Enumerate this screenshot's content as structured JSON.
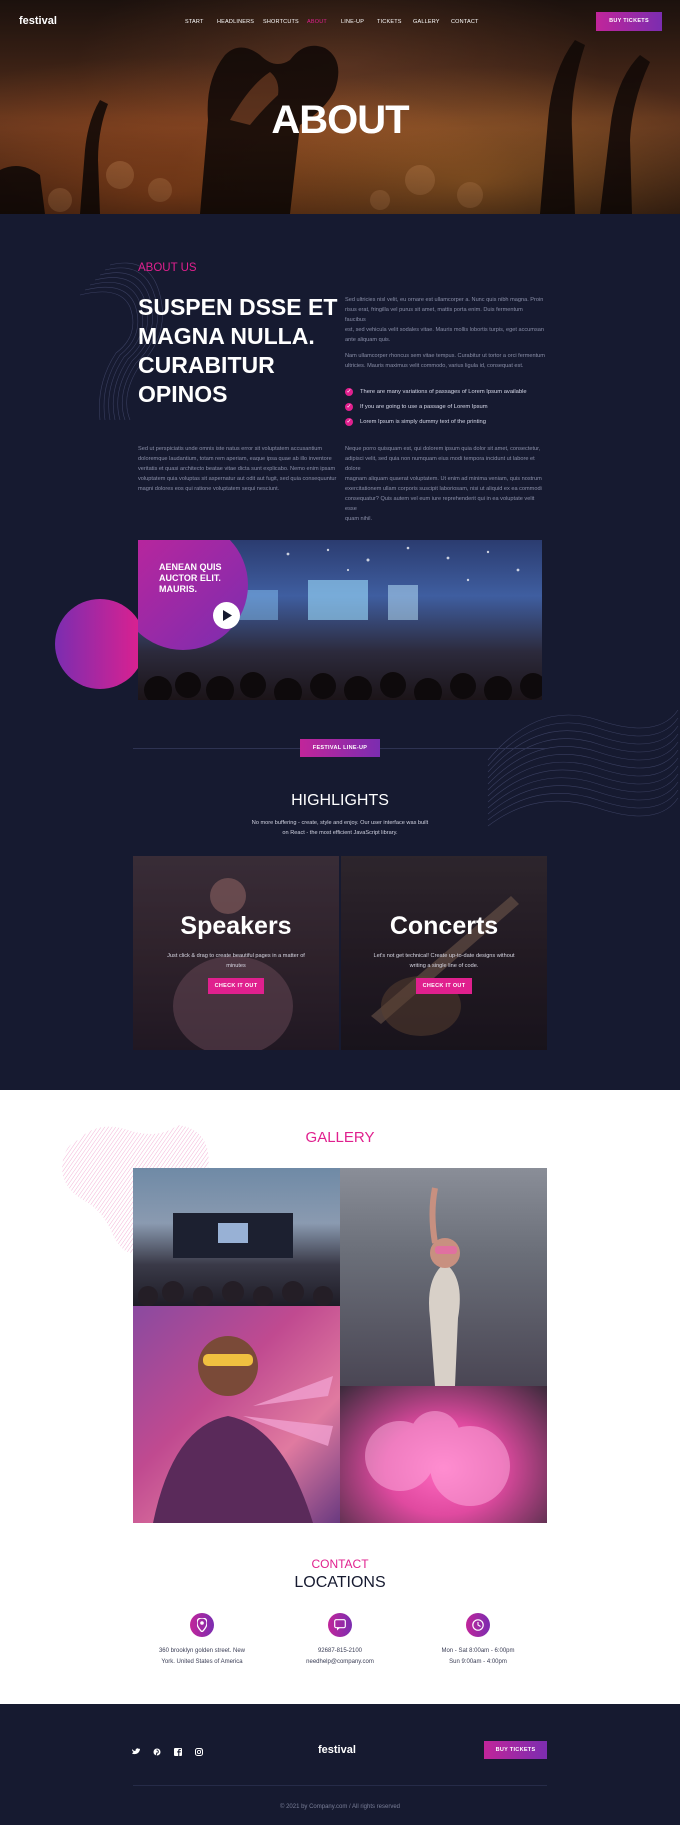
{
  "header": {
    "logo": "festival",
    "nav": [
      "START",
      "HEADLINERS",
      "SHORTCUTS",
      "ABOUT",
      "LINE-UP",
      "TICKETS",
      "GALLERY",
      "CONTACT"
    ],
    "buy_label": "BUY TICKETS"
  },
  "hero": {
    "title": "ABOUT"
  },
  "about": {
    "eyebrow": "ABOUT US",
    "heading": [
      "SUSPEN DSSE ET",
      "MAGNA NULLA.",
      "CURABITUR",
      "OPINOS"
    ],
    "right_p1": [
      "Sed ultricies nisl velit, eu ornare est ullamcorper a. Nunc quis nibh magna. Proin",
      "risus erat, fringilla vel purus sit amet, mattis porta enim. Duis fermentum faucibus",
      "est, sed vehicula velit sodales vitae. Mauris mollis lobortis turpis, eget accumsan",
      "ante aliquam quis."
    ],
    "right_p2": [
      "Nam ullamcorper rhoncus sem vitae tempus. Curabitur ut tortor a orci fermentum",
      "ultricies. Mauris maximus velit commodo, varius ligula id, consequat est."
    ],
    "checks": [
      "There are many variations of passages of Lorem Ipsum available",
      "If you are going to use a passage of Lorem Ipsum",
      "Lorem Ipsum is simply dummy text of the printing"
    ],
    "left_p3": [
      "Sed ut perspiciatis unde omnis iste natus error sit voluptatem accusantium",
      "doloremque laudantium, totam rem aperiam, eaque ipsa quae ab illo inventore",
      "veritatis et quasi architecto beatae vitae dicta sunt explicabo. Nemo enim ipsam",
      "voluptatem quia voluptas sit aspernatur aut odit aut fugit, sed quia consequuntur",
      "magni dolores eos qui ratione voluptatem sequi nesciunt."
    ],
    "right_p3": [
      "Neque porro quisquam est, qui dolorem ipsum quia dolor sit amet, consectetur,",
      "adipisci velit, sed quia non numquam eius modi tempora incidunt ut labore et dolore",
      "magnam aliquam quaerat voluptatem. Ut enim ad minima veniam, quis nostrum",
      "exercitationem ullam corporis suscipit laboriosam, nisi ut aliquid ex ea commodi",
      "consequatur? Quis autem vel eum iure reprehenderit qui in ea voluptate velit esse",
      "quam nihil."
    ]
  },
  "video": {
    "caption": [
      "AENEAN QUIS",
      "AUCTOR ELIT.",
      "MAURIS."
    ]
  },
  "lineup": {
    "badge": "FESTIVAL LINE-UP"
  },
  "highlights": {
    "title": "HIGHLIGHTS",
    "subtitle": [
      "No more buffering - create, style and enjoy. Our user interface was built",
      "on React - the most efficient JavaScript library."
    ],
    "cards": [
      {
        "title": "Speakers",
        "desc": [
          "Just click & drag to create beautiful pages in a matter of",
          "minutes"
        ],
        "button": "CHECK IT OUT"
      },
      {
        "title": "Concerts",
        "desc": [
          "Let's not get technical! Create up-to-date designs without",
          "writing a single line of code."
        ],
        "button": "CHECK IT OUT"
      }
    ]
  },
  "gallery": {
    "title": "GALLERY"
  },
  "contact": {
    "eyebrow": "CONTACT",
    "title": "LOCATIONS",
    "items": [
      {
        "icon": "location-pin-icon",
        "lines": [
          "360 brooklyn golden street. New",
          "York. United States of America"
        ]
      },
      {
        "icon": "chat-bubble-icon",
        "lines": [
          "92687-815-2100",
          "needhelp@company.com"
        ]
      },
      {
        "icon": "clock-icon",
        "lines": [
          "Mon - Sat 8:00am - 6:00pm",
          "Sun 9:00am - 4:00pm"
        ]
      }
    ]
  },
  "footer": {
    "logo": "festival",
    "buy_label": "BUY TICKETS",
    "social_icons": [
      "twitter-icon",
      "pinterest-icon",
      "facebook-icon",
      "instagram-icon"
    ],
    "copyright": "© 2021 by Company.com  /  All rights reserved"
  },
  "colors": {
    "accent": "#e0208e",
    "accent2": "#7b2db0",
    "dark_bg": "#161a30",
    "light_bg": "#ffffff"
  }
}
